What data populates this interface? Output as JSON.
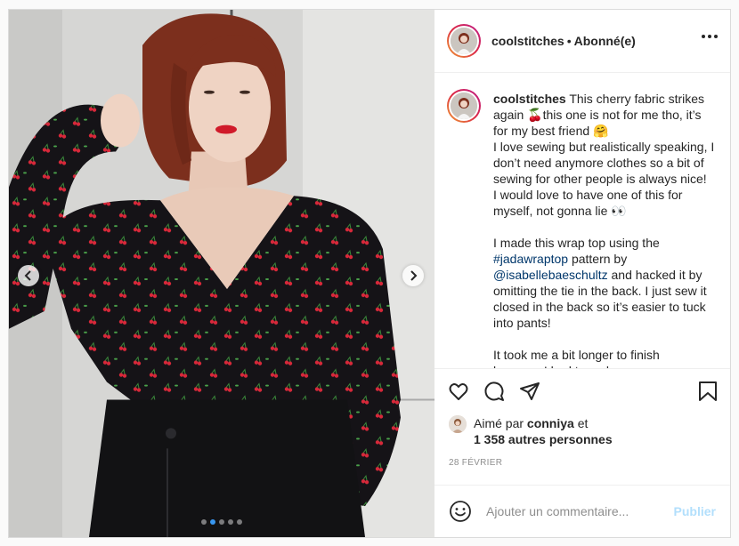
{
  "header": {
    "username": "coolstitches",
    "separator": "•",
    "follow_status": "Abonné(e)"
  },
  "caption": {
    "username": "coolstitches",
    "part1": " This cherry fabric strikes again 🍒this one is not for me tho, it’s for my best friend 🤗\nI love sewing but realistically speaking, I don’t need anymore clothes so a bit of sewing for other people is always nice!\nI would love to have one of this for myself, not gonna lie 👀\n\nI made this wrap top using the ",
    "hashtag": "#jadawraptop",
    "part2": " pattern by ",
    "mention": "@isabellebaeschultz",
    "part3": " and hacked it by omitting the tie in the back. I just sew it closed in the back so it’s easier to tuck into pants!\n\nIt took me a bit longer to finish\nbecause I had to make…"
  },
  "likes": {
    "prefix": "Aimé par ",
    "user": "conniya",
    "mid": " et",
    "others": "1 358 autres personnes"
  },
  "date": "28 FÉVRIER",
  "comment": {
    "placeholder": "Ajouter un commentaire...",
    "post_label": "Publier"
  },
  "carousel": {
    "slide_count": 5,
    "active_index": 1
  },
  "colors": {
    "post_button": "#b2dffc",
    "active_dot": "#3897f0",
    "link": "#00376b"
  },
  "icons": [
    "heart-icon",
    "comment-icon",
    "share-icon",
    "bookmark-icon",
    "emoji-icon",
    "more-icon",
    "chevron-left-icon",
    "chevron-right-icon"
  ]
}
